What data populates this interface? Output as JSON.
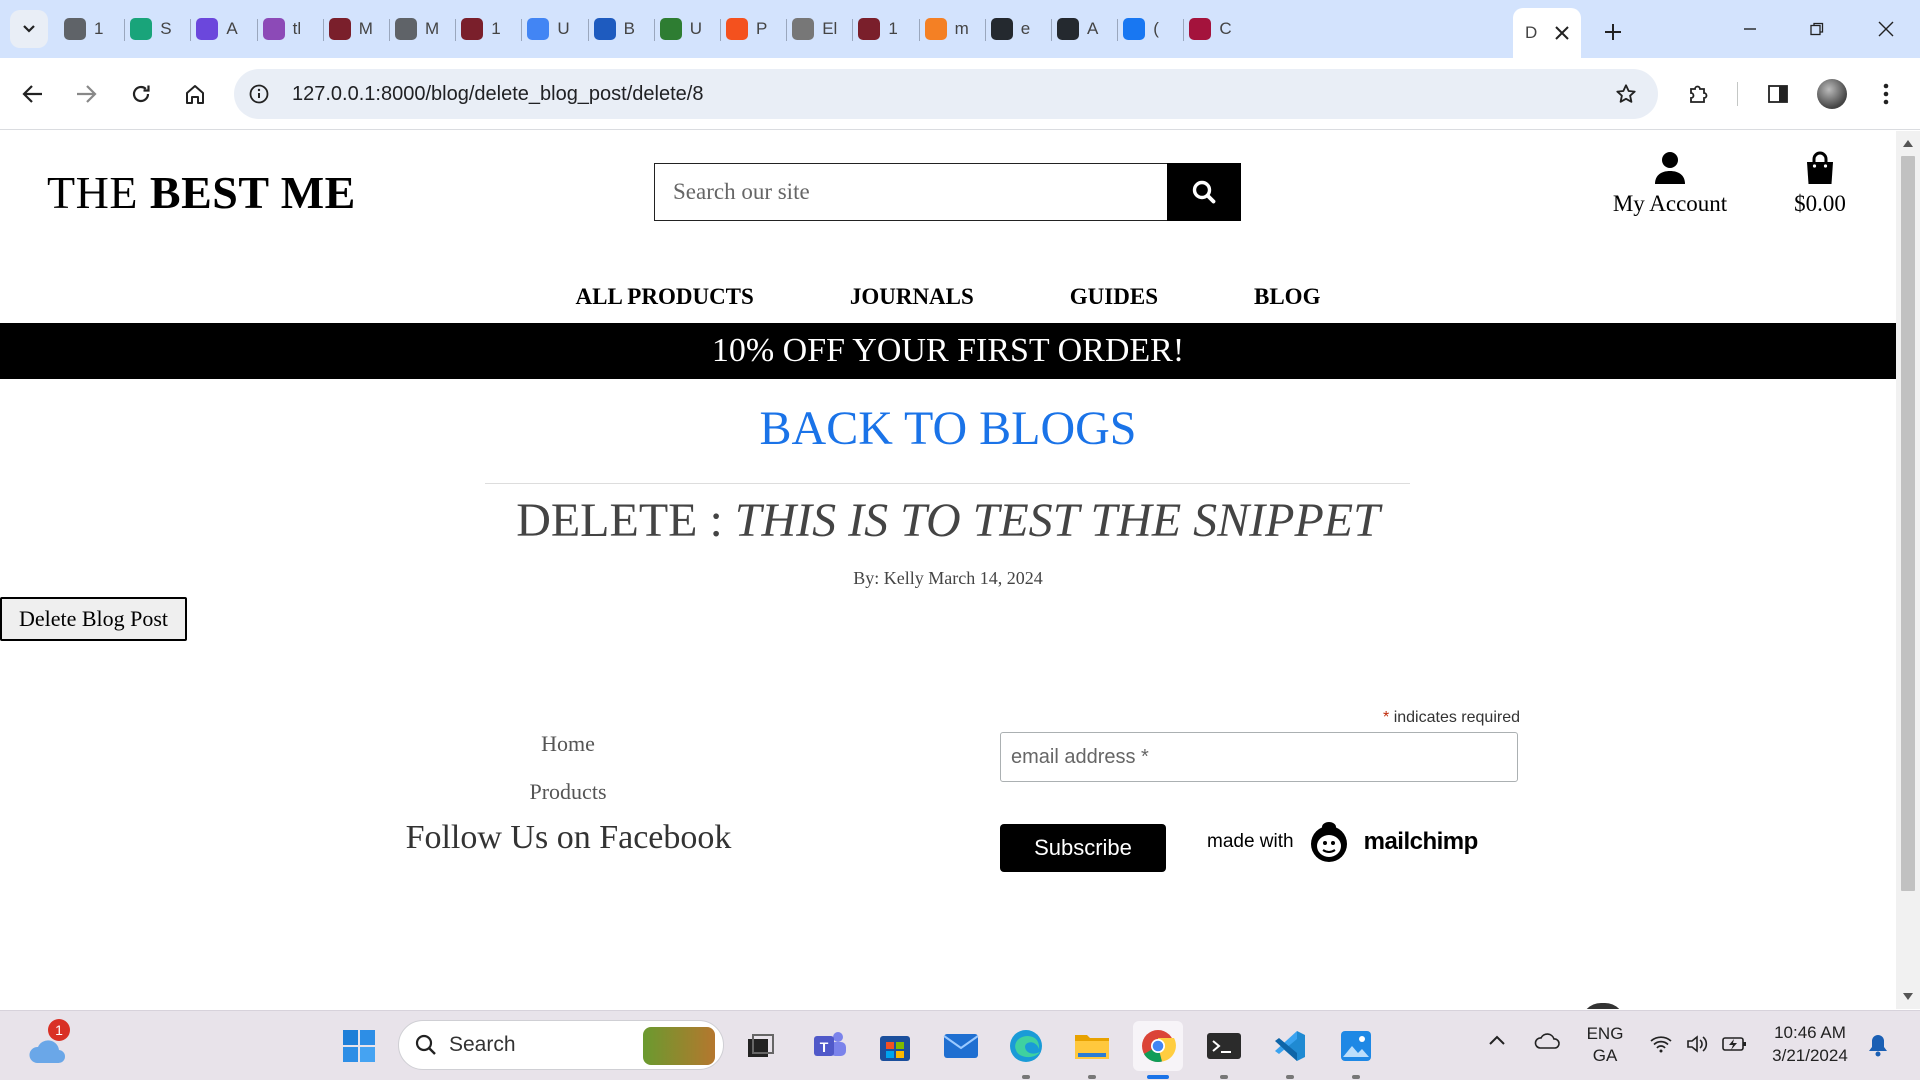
{
  "browser": {
    "tabs": [
      {
        "letter": "1",
        "color": "#5f6368"
      },
      {
        "letter": "S",
        "color": "#19a47a"
      },
      {
        "letter": "A",
        "color": "#6b47dc"
      },
      {
        "letter": "tl",
        "color": "#8c4ab7"
      },
      {
        "letter": "M",
        "color": "#7a1f2b"
      },
      {
        "letter": "M",
        "color": "#5f6368"
      },
      {
        "letter": "1",
        "color": "#7a1f2b"
      },
      {
        "letter": "U",
        "color": "#4285f4"
      },
      {
        "letter": "B",
        "color": "#1e5bbf"
      },
      {
        "letter": "U",
        "color": "#2e7d32"
      },
      {
        "letter": "P",
        "color": "#f4511e"
      },
      {
        "letter": "El",
        "color": "#777777"
      },
      {
        "letter": "1",
        "color": "#7a1f2b"
      },
      {
        "letter": "m",
        "color": "#f48024"
      },
      {
        "letter": "e",
        "color": "#24292f"
      },
      {
        "letter": "A",
        "color": "#24292f"
      },
      {
        "letter": "(",
        "color": "#1877f2"
      },
      {
        "letter": "C",
        "color": "#a4133c"
      }
    ],
    "active_tab_letter": "D",
    "url": "127.0.0.1:8000/blog/delete_blog_post/delete/8"
  },
  "site": {
    "logo_plain": "THE ",
    "logo_bold": "BEST ME",
    "search_placeholder": "Search our site",
    "account_label": "My Account",
    "cart_total": "$0.00",
    "nav": [
      "ALL PRODUCTS",
      "JOURNALS",
      "GUIDES",
      "BLOG"
    ],
    "promo": "10% OFF YOUR FIRST ORDER!"
  },
  "main": {
    "back_link": "BACK TO BLOGS",
    "delete_prefix": "DELETE : ",
    "post_title": "THIS IS TO TEST THE SNIPPET",
    "byline": "By: Kelly March 14, 2024",
    "delete_button": "Delete Blog Post"
  },
  "footer": {
    "links": [
      "Home",
      "Products"
    ],
    "follow": "Follow Us on Facebook",
    "required_star": "*",
    "required_note": " indicates required",
    "email_placeholder": "email address *",
    "subscribe": "Subscribe",
    "made_with": "made with",
    "mailchimp": "mailchimp"
  },
  "taskbar": {
    "search": "Search",
    "weather_badge": "1",
    "lang_top": "ENG",
    "lang_bottom": "GA",
    "time": "10:46 AM",
    "date": "3/21/2024"
  }
}
